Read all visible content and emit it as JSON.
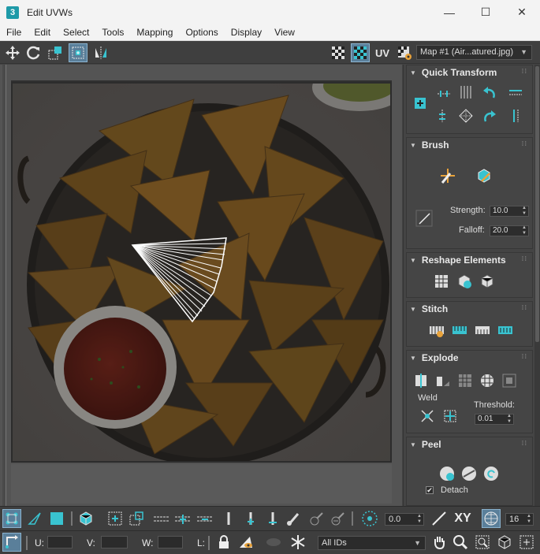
{
  "window": {
    "title": "Edit UVWs",
    "app_icon_label": "3",
    "controls": {
      "minimize": "—",
      "maximize": "☐",
      "close": "✕"
    }
  },
  "menu": [
    "File",
    "Edit",
    "Select",
    "Tools",
    "Mapping",
    "Options",
    "Display",
    "View"
  ],
  "toolbar": {
    "uv_label": "UV",
    "map_select": "Map #1 (Air...atured.jpg)"
  },
  "panel": {
    "quick_transform": {
      "title": "Quick Transform"
    },
    "brush": {
      "title": "Brush",
      "strength_label": "Strength:",
      "strength_value": "10.0",
      "falloff_label": "Falloff:",
      "falloff_value": "20.0"
    },
    "reshape": {
      "title": "Reshape Elements"
    },
    "stitch": {
      "title": "Stitch"
    },
    "explode": {
      "title": "Explode",
      "weld_label": "Weld",
      "threshold_label": "Threshold:",
      "threshold_value": "0.01"
    },
    "peel": {
      "title": "Peel",
      "detach_label": "Detach",
      "detach_checked": true
    }
  },
  "bottom": {
    "rotate_value": "0.0",
    "xy_label": "XY",
    "grid_value": "16",
    "u_label": "U:",
    "v_label": "V:",
    "w_label": "W:",
    "l_label": "L:",
    "ids_select": "All IDs"
  },
  "colors": {
    "accent_teal": "#39c3d0",
    "active_button": "#5a7f9a"
  }
}
